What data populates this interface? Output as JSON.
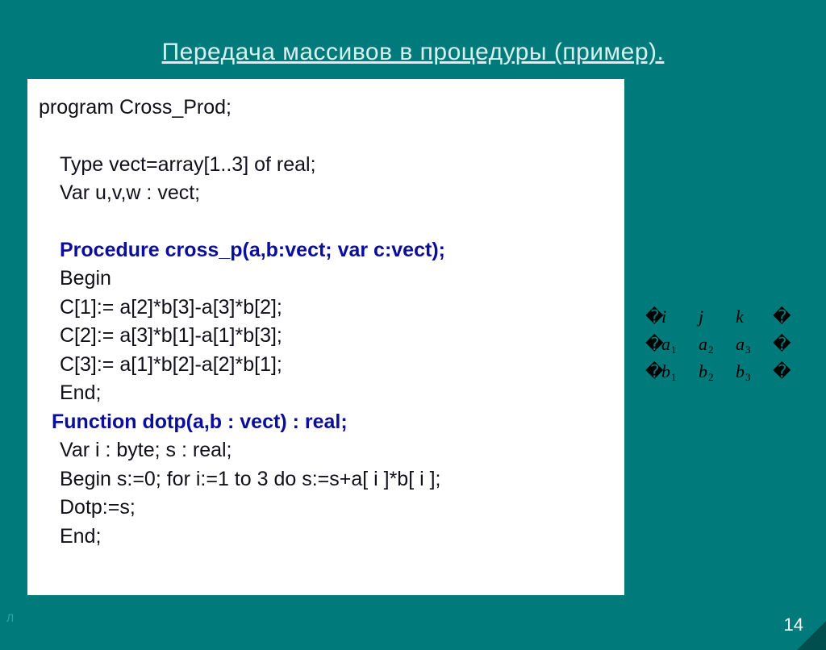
{
  "title": "Передача массивов в процедуры (пример).",
  "code": {
    "l1": "program Cross_Prod;",
    "l2": "Type vect=array[1..3] of real;",
    "l3": "Var u,v,w : vect;",
    "l4": "Procedure cross_p(a,b:vect; var c:vect);",
    "l5": "Begin",
    "l6": "C[1]:= a[2]*b[3]-a[3]*b[2];",
    "l7": "C[2]:= a[3]*b[1]-a[1]*b[3];",
    "l8": "C[3]:= a[1]*b[2]-a[2]*b[1];",
    "l9": "End;",
    "l10": "Function dotp(a,b : vect) : real;",
    "l11": "Var i : byte; s : real;",
    "l12": "Begin    s:=0;    for i:=1 to 3 do s:=s+a[ i ]*b[ i ];",
    "l13": "Dotp:=s;",
    "l14": "End;"
  },
  "matrix": {
    "row1": {
      "c1_base": "i",
      "c2_base": "j",
      "c3_base": "k"
    },
    "row2": {
      "c1_base": "a",
      "c1_sub": "1",
      "c2_base": "a",
      "c2_sub": "2",
      "c3_base": "a",
      "c3_sub": "3"
    },
    "row3": {
      "c1_base": "b",
      "c1_sub": "1",
      "c2_base": "b",
      "c2_sub": "2",
      "c3_base": "b",
      "c3_sub": "3"
    },
    "bracket": "�"
  },
  "page_number": "14",
  "edge_marker": "Л"
}
